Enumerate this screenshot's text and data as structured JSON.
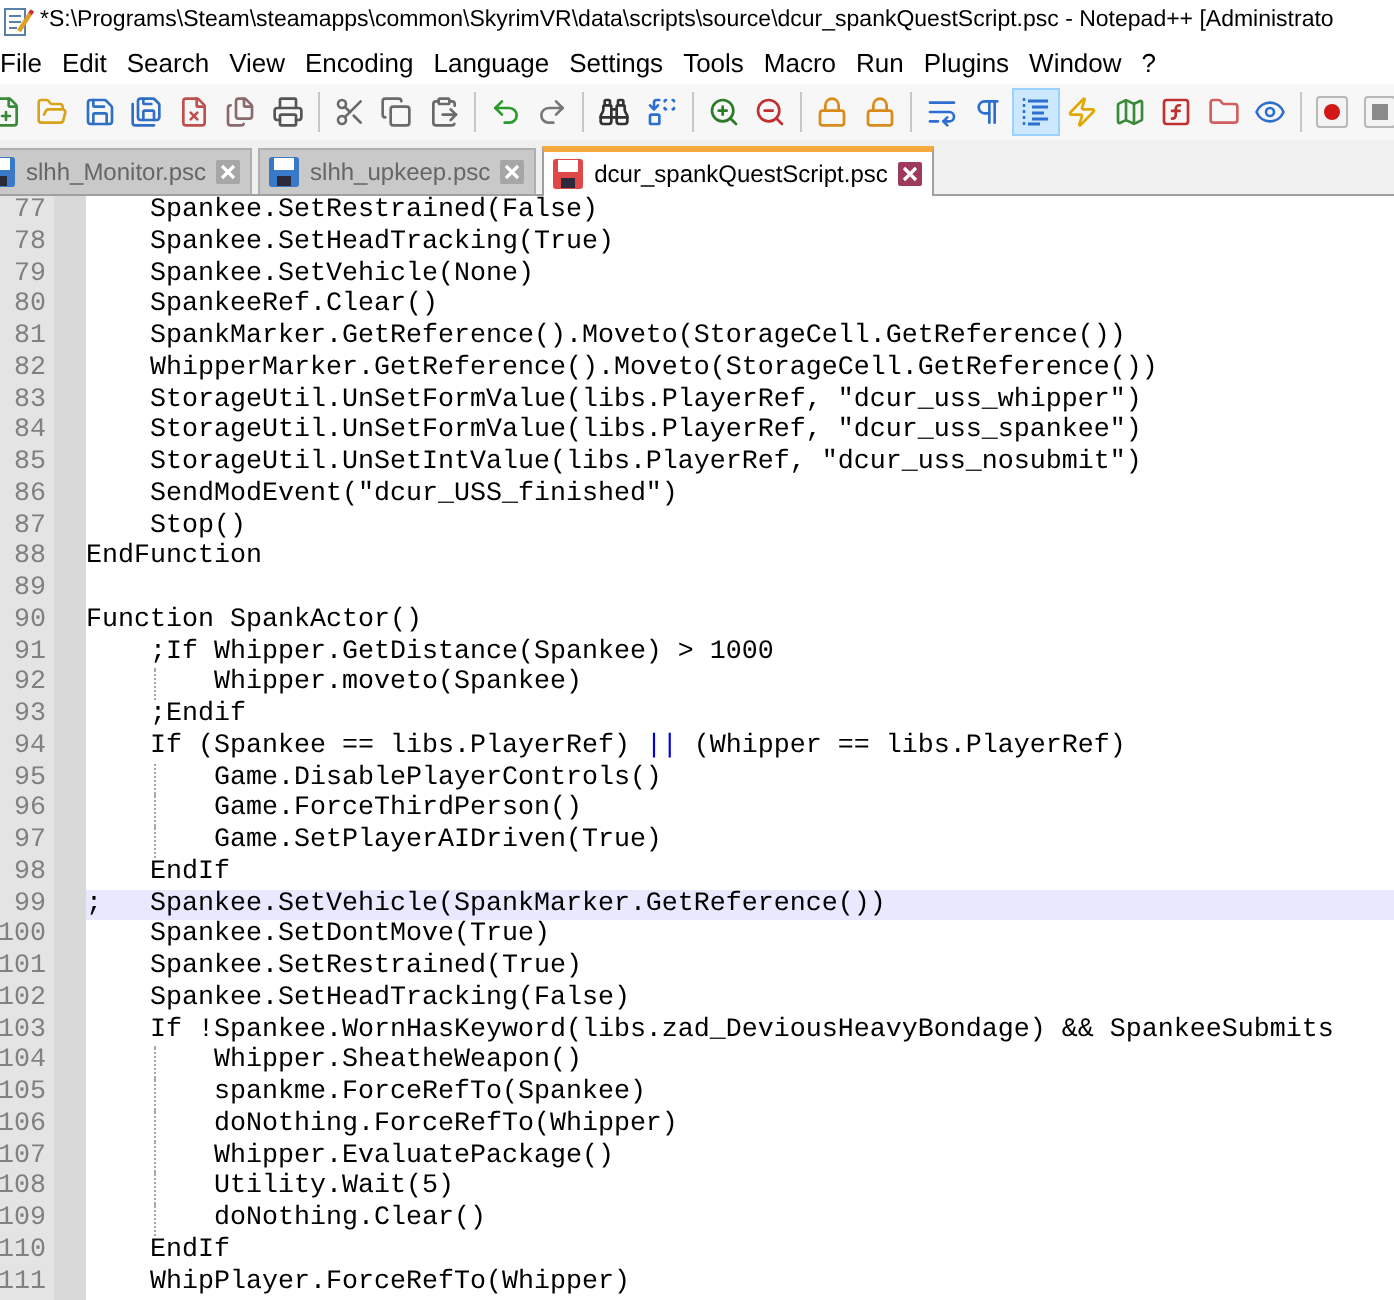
{
  "window": {
    "title": "*S:\\Programs\\Steam\\steamapps\\common\\SkyrimVR\\data\\scripts\\source\\dcur_spankQuestScript.psc - Notepad++ [Administrato"
  },
  "menu": [
    "File",
    "Edit",
    "Search",
    "View",
    "Encoding",
    "Language",
    "Settings",
    "Tools",
    "Macro",
    "Run",
    "Plugins",
    "Window",
    "?"
  ],
  "toolbar": {
    "buttons": [
      {
        "on": false
      },
      {
        "on": false
      },
      {
        "on": false
      },
      {
        "on": false
      },
      {
        "on": false
      },
      {
        "on": false
      },
      {
        "on": false
      },
      {
        "on": false
      },
      {
        "on": false
      },
      {
        "on": false
      },
      {
        "on": false
      },
      {
        "on": false
      },
      {
        "on": false
      },
      {
        "on": false
      },
      {
        "on": false
      },
      {
        "on": false
      },
      {
        "on": false
      },
      {
        "on": false
      },
      {
        "on": false
      },
      {
        "on": false
      },
      {
        "on": true
      },
      {
        "on": false
      },
      {
        "on": false
      },
      {
        "on": false
      },
      {
        "on": false
      },
      {
        "on": false
      },
      {
        "on": false
      },
      {
        "on": false
      }
    ]
  },
  "tabs": [
    {
      "label": "slhh_Monitor.psc",
      "selected": false,
      "modified": false
    },
    {
      "label": "slhh_upkeep.psc",
      "selected": false,
      "modified": false
    },
    {
      "label": "dcur_spankQuestScript.psc",
      "selected": true,
      "modified": true
    }
  ],
  "editor": {
    "lines": [
      {
        "number": "77",
        "current": false,
        "segments": [
          {
            "kind": "plain",
            "text": "    Spankee.SetRestrained(False)"
          }
        ]
      },
      {
        "number": "78",
        "current": false,
        "segments": [
          {
            "kind": "plain",
            "text": "    Spankee.SetHeadTracking(True)"
          }
        ]
      },
      {
        "number": "79",
        "current": false,
        "segments": [
          {
            "kind": "plain",
            "text": "    Spankee.SetVehicle(None)"
          }
        ]
      },
      {
        "number": "80",
        "current": false,
        "segments": [
          {
            "kind": "plain",
            "text": "    SpankeeRef.Clear()"
          }
        ]
      },
      {
        "number": "81",
        "current": false,
        "segments": [
          {
            "kind": "plain",
            "text": "    SpankMarker.GetReference().Moveto(StorageCell.GetReference())"
          }
        ]
      },
      {
        "number": "82",
        "current": false,
        "segments": [
          {
            "kind": "plain",
            "text": "    WhipperMarker.GetReference().Moveto(StorageCell.GetReference())"
          }
        ]
      },
      {
        "number": "83",
        "current": false,
        "segments": [
          {
            "kind": "plain",
            "text": "    StorageUtil.UnSetFormValue(libs.PlayerRef, \"dcur_uss_whipper\")"
          }
        ]
      },
      {
        "number": "84",
        "current": false,
        "segments": [
          {
            "kind": "plain",
            "text": "    StorageUtil.UnSetFormValue(libs.PlayerRef, \"dcur_uss_spankee\")"
          }
        ]
      },
      {
        "number": "85",
        "current": false,
        "segments": [
          {
            "kind": "plain",
            "text": "    StorageUtil.UnSetIntValue(libs.PlayerRef, \"dcur_uss_nosubmit\")"
          }
        ]
      },
      {
        "number": "86",
        "current": false,
        "segments": [
          {
            "kind": "plain",
            "text": "    SendModEvent(\"dcur_USS_finished\")"
          }
        ]
      },
      {
        "number": "87",
        "current": false,
        "segments": [
          {
            "kind": "plain",
            "text": "    Stop()"
          }
        ]
      },
      {
        "number": "88",
        "current": false,
        "segments": [
          {
            "kind": "plain",
            "text": "EndFunction"
          }
        ]
      },
      {
        "number": "89",
        "current": false
      },
      {
        "number": "90",
        "current": false,
        "segments": [
          {
            "kind": "plain",
            "text": "Function SpankActor()"
          }
        ]
      },
      {
        "number": "91",
        "current": false,
        "segments": [
          {
            "kind": "plain",
            "text": "    ;If Whipper.GetDistance(Spankee) > 1000"
          }
        ]
      },
      {
        "number": "92",
        "current": false,
        "segments": [
          {
            "kind": "plain",
            "text": "        Whipper.moveto(Spankee)"
          }
        ]
      },
      {
        "number": "93",
        "current": false,
        "segments": [
          {
            "kind": "plain",
            "text": "    ;Endif"
          }
        ]
      },
      {
        "number": "94",
        "current": false,
        "segments": [
          {
            "kind": "plain",
            "text": "    If (Spankee == libs.PlayerRef) "
          },
          {
            "kind": "operator",
            "text": "||"
          },
          {
            "kind": "plain",
            "text": " (Whipper == libs.PlayerRef)"
          }
        ]
      },
      {
        "number": "95",
        "current": false,
        "segments": [
          {
            "kind": "plain",
            "text": "        Game.DisablePlayerControls()"
          }
        ]
      },
      {
        "number": "96",
        "current": false,
        "segments": [
          {
            "kind": "plain",
            "text": "        Game.ForceThirdPerson()"
          }
        ]
      },
      {
        "number": "97",
        "current": false,
        "segments": [
          {
            "kind": "plain",
            "text": "        Game.SetPlayerAIDriven(True)"
          }
        ]
      },
      {
        "number": "98",
        "current": false,
        "segments": [
          {
            "kind": "plain",
            "text": "    EndIf"
          }
        ]
      },
      {
        "number": "99",
        "current": true,
        "segments": [
          {
            "kind": "plain",
            "text": ";   Spankee.SetVehicle(SpankMarker.GetReference())"
          }
        ]
      },
      {
        "number": "100",
        "current": false,
        "segments": [
          {
            "kind": "plain",
            "text": "    Spankee.SetDontMove(True)"
          }
        ]
      },
      {
        "number": "101",
        "current": false,
        "segments": [
          {
            "kind": "plain",
            "text": "    Spankee.SetRestrained(True)"
          }
        ]
      },
      {
        "number": "102",
        "current": false,
        "segments": [
          {
            "kind": "plain",
            "text": "    Spankee.SetHeadTracking(False)"
          }
        ]
      },
      {
        "number": "103",
        "current": false,
        "segments": [
          {
            "kind": "plain",
            "text": "    If !Spankee.WornHasKeyword(libs.zad_DeviousHeavyBondage) && SpankeeSubmits"
          }
        ]
      },
      {
        "number": "104",
        "current": false,
        "segments": [
          {
            "kind": "plain",
            "text": "        Whipper.SheatheWeapon()"
          }
        ]
      },
      {
        "number": "105",
        "current": false,
        "segments": [
          {
            "kind": "plain",
            "text": "        spankme.ForceRefTo(Spankee)"
          }
        ]
      },
      {
        "number": "106",
        "current": false,
        "segments": [
          {
            "kind": "plain",
            "text": "        doNothing.ForceRefTo(Whipper)"
          }
        ]
      },
      {
        "number": "107",
        "current": false,
        "segments": [
          {
            "kind": "plain",
            "text": "        Whipper.EvaluatePackage()"
          }
        ]
      },
      {
        "number": "108",
        "current": false,
        "segments": [
          {
            "kind": "plain",
            "text": "        Utility.Wait(5)"
          }
        ]
      },
      {
        "number": "109",
        "current": false,
        "segments": [
          {
            "kind": "plain",
            "text": "        doNothing.Clear()"
          }
        ]
      },
      {
        "number": "110",
        "current": false,
        "segments": [
          {
            "kind": "plain",
            "text": "    EndIf"
          }
        ]
      },
      {
        "number": "111",
        "current": false,
        "segments": [
          {
            "kind": "plain",
            "text": "    WhipPlayer.ForceRefTo(Whipper)"
          }
        ]
      }
    ]
  }
}
